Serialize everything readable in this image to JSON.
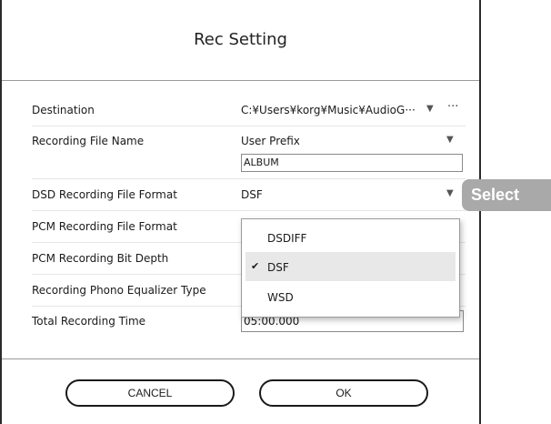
{
  "dialog": {
    "title": "Rec Setting"
  },
  "settings": {
    "destination": {
      "label": "Destination",
      "value": "C:¥Users¥korg¥Music¥AudioG···",
      "arrow": "▼",
      "more": "···"
    },
    "file_name": {
      "label": "Recording File Name",
      "value": "User Prefix",
      "arrow": "▼",
      "prefix_field": "ALBUM"
    },
    "dsd_format": {
      "label": "DSD Recording File Format",
      "value": "DSF",
      "arrow": "▼"
    },
    "pcm_format": {
      "label": "PCM Recording File Format"
    },
    "pcm_depth": {
      "label": "PCM Recording Bit Depth"
    },
    "phono_eq": {
      "label": "Recording Phono Equalizer Type"
    },
    "total_time": {
      "label": "Total Recording Time",
      "value": "05:00.000"
    }
  },
  "dropdown": {
    "options": [
      "DSDIFF",
      "DSF",
      "WSD"
    ],
    "selected": "DSF",
    "check": "✔"
  },
  "buttons": {
    "cancel": "CANCEL",
    "ok": "OK"
  },
  "callout": {
    "text": "Select"
  }
}
